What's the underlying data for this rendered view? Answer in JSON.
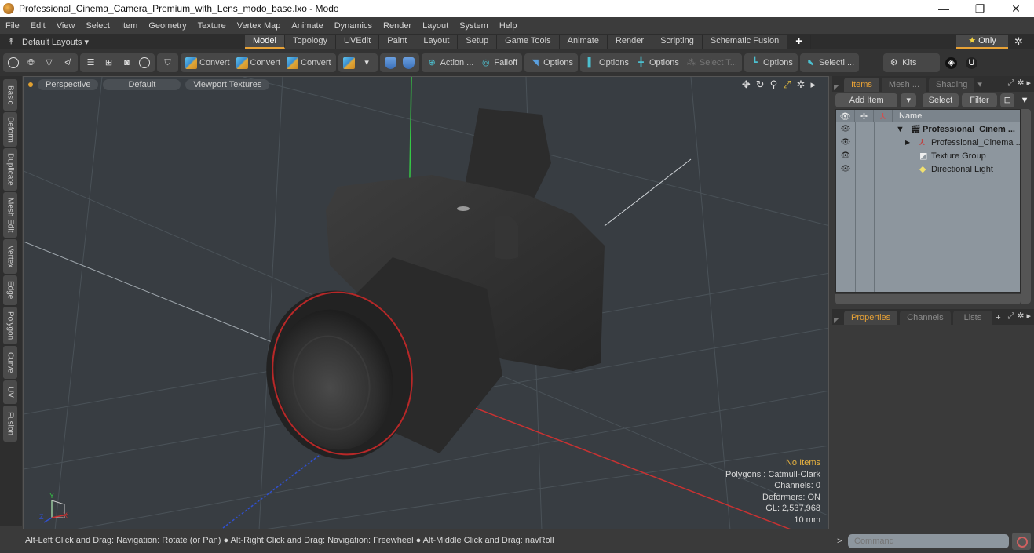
{
  "window": {
    "title": "Professional_Cinema_Camera_Premium_with_Lens_modo_base.lxo - Modo",
    "minimize": "—",
    "restore": "❐",
    "close": "✕"
  },
  "menu": [
    "File",
    "Edit",
    "View",
    "Select",
    "Item",
    "Geometry",
    "Texture",
    "Vertex Map",
    "Animate",
    "Dynamics",
    "Render",
    "Layout",
    "System",
    "Help"
  ],
  "layoutbar": {
    "layouts_label": "Default Layouts ▾",
    "tabs": [
      "Model",
      "Topology",
      "UVEdit",
      "Paint",
      "Layout",
      "Setup",
      "Game Tools",
      "Animate",
      "Render",
      "Scripting",
      "Schematic Fusion"
    ],
    "active_tab": "Model",
    "add_tab": "+",
    "only_label": "Only",
    "star": "★",
    "gear": "✲"
  },
  "toolbar": {
    "convert1": "Convert",
    "convert2": "Convert",
    "convert3": "Convert",
    "action": "Action",
    "action_more": "...",
    "falloff": "Falloff",
    "options1": "Options",
    "options2": "Options",
    "options3": "Options",
    "select_t": "Select T...",
    "options4": "Options",
    "selecti": "Selecti ...",
    "kits": "Kits"
  },
  "left_tabs": [
    "Basic",
    "Deform",
    "Duplicate",
    "Mesh Edit",
    "Vertex",
    "Edge",
    "Polygon",
    "Curve",
    "UV",
    "Fusion"
  ],
  "viewport": {
    "view_mode": "Perspective",
    "shading": "Default",
    "textures": "Viewport Textures",
    "info": {
      "selection": "No Items",
      "polygons": "Polygons : Catmull-Clark",
      "channels": "Channels: 0",
      "deformers": "Deformers: ON",
      "gl": "GL: 2,537,968",
      "scale": "10 mm"
    },
    "axis_y": "Y",
    "axis_z": "Z",
    "axis_x": "X"
  },
  "items_panel": {
    "tabs": [
      "Items",
      "Mesh ...",
      "Shading"
    ],
    "active_tab": "Items",
    "add_item": "Add Item",
    "select": "Select",
    "filter": "Filter",
    "column_name": "Name",
    "rows": [
      {
        "name": "Professional_Cinem ...",
        "type": "scene",
        "bold": true,
        "expander": "▼"
      },
      {
        "name": "Professional_Cinema ...",
        "type": "mesh",
        "bold": false,
        "expander": "▶"
      },
      {
        "name": "Texture Group",
        "type": "texture-group",
        "bold": false,
        "expander": ""
      },
      {
        "name": "Directional Light",
        "type": "light",
        "bold": false,
        "expander": ""
      }
    ]
  },
  "properties_panel": {
    "tabs": [
      "Properties",
      "Channels",
      "Lists"
    ],
    "active_tab": "Properties",
    "add": "+"
  },
  "status": {
    "message": "Alt-Left Click and Drag: Navigation: Rotate (or Pan) ● Alt-Right Click and Drag: Navigation: Freewheel ● Alt-Middle Click and Drag: navRoll"
  },
  "command": {
    "prompt": ">",
    "placeholder": "Command"
  },
  "colors": {
    "accent": "#e8a236",
    "info_highlight": "#e8b340",
    "axis_x": "#d03030",
    "axis_y": "#30c040",
    "axis_z": "#3050d0"
  }
}
